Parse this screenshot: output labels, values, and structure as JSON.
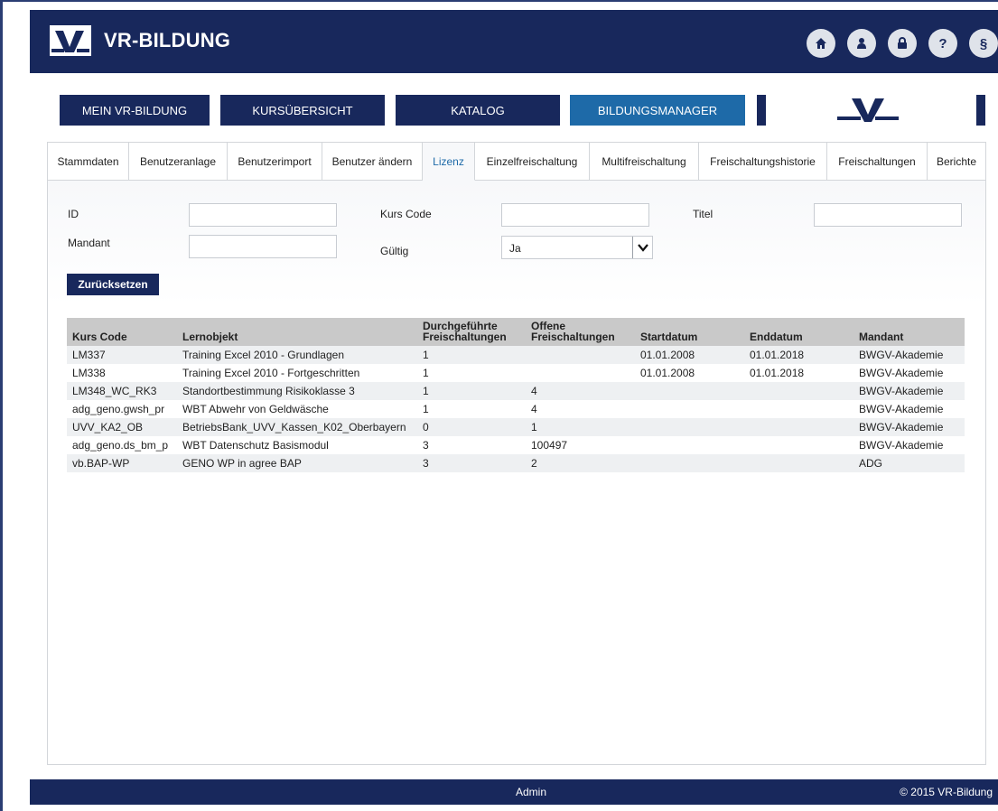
{
  "header": {
    "logo_text": "VR-BILDUNG",
    "icons": [
      {
        "name": "home-icon",
        "glyph": "⌂"
      },
      {
        "name": "user-icon",
        "glyph": "●"
      },
      {
        "name": "lock-icon",
        "glyph": "▣"
      },
      {
        "name": "help-icon",
        "glyph": "?"
      },
      {
        "name": "legal-icon",
        "glyph": "§"
      }
    ]
  },
  "nav": {
    "items": [
      "MEIN VR-BILDUNG",
      "KURSÜBERSICHT",
      "KATALOG",
      "BILDUNGSMANAGER"
    ],
    "active": "BILDUNGSMANAGER"
  },
  "tabs": {
    "items": [
      "Stammdaten",
      "Benutzeranlage",
      "Benutzerimport",
      "Benutzer ändern",
      "Lizenz",
      "Einzelfreischaltung",
      "Multifreischaltung",
      "Freischaltungshistorie",
      "Freischaltungen",
      "Berichte"
    ],
    "active": "Lizenz"
  },
  "filters": {
    "id_label": "ID",
    "kurs_code_label": "Kurs Code",
    "titel_label": "Titel",
    "mandant_label": "Mandant",
    "gueltig_label": "Gültig",
    "gueltig_value": "Ja",
    "reset_label": "Zurücksetzen"
  },
  "table": {
    "headers": [
      "Kurs Code",
      "Lernobjekt",
      "Durchgeführte Freischaltungen",
      "Offene Freischaltungen",
      "Startdatum",
      "Enddatum",
      "Mandant"
    ],
    "rows": [
      [
        "LM337",
        "Training Excel 2010 - Grundlagen",
        "1",
        "",
        "01.01.2008",
        "01.01.2018",
        "BWGV-Akademie"
      ],
      [
        "LM338",
        "Training Excel 2010 - Fortgeschritten",
        "1",
        "",
        "01.01.2008",
        "01.01.2018",
        "BWGV-Akademie"
      ],
      [
        "LM348_WC_RK3",
        "Standortbestimmung Risikoklasse 3",
        "1",
        "4",
        "",
        "",
        "BWGV-Akademie"
      ],
      [
        "adg_geno.gwsh_pr",
        "WBT Abwehr von Geldwäsche",
        "1",
        "4",
        "",
        "",
        "BWGV-Akademie"
      ],
      [
        "UVV_KA2_OB",
        "BetriebsBank_UVV_Kassen_K02_Oberbayern",
        "0",
        "1",
        "",
        "",
        "BWGV-Akademie"
      ],
      [
        "adg_geno.ds_bm_p",
        "WBT Datenschutz Basismodul",
        "3",
        "100497",
        "",
        "",
        "BWGV-Akademie"
      ],
      [
        "vb.BAP-WP",
        "GENO WP in agree BAP",
        "3",
        "2",
        "",
        "",
        "ADG"
      ]
    ]
  },
  "footer": {
    "center": "Admin",
    "right": "© 2015 VR-Bildung"
  },
  "colors": {
    "brand_dark": "#18285c",
    "brand_active": "#1e6aa8",
    "table_header": "#c9c9c9",
    "row_alt": "#eef0f2"
  }
}
